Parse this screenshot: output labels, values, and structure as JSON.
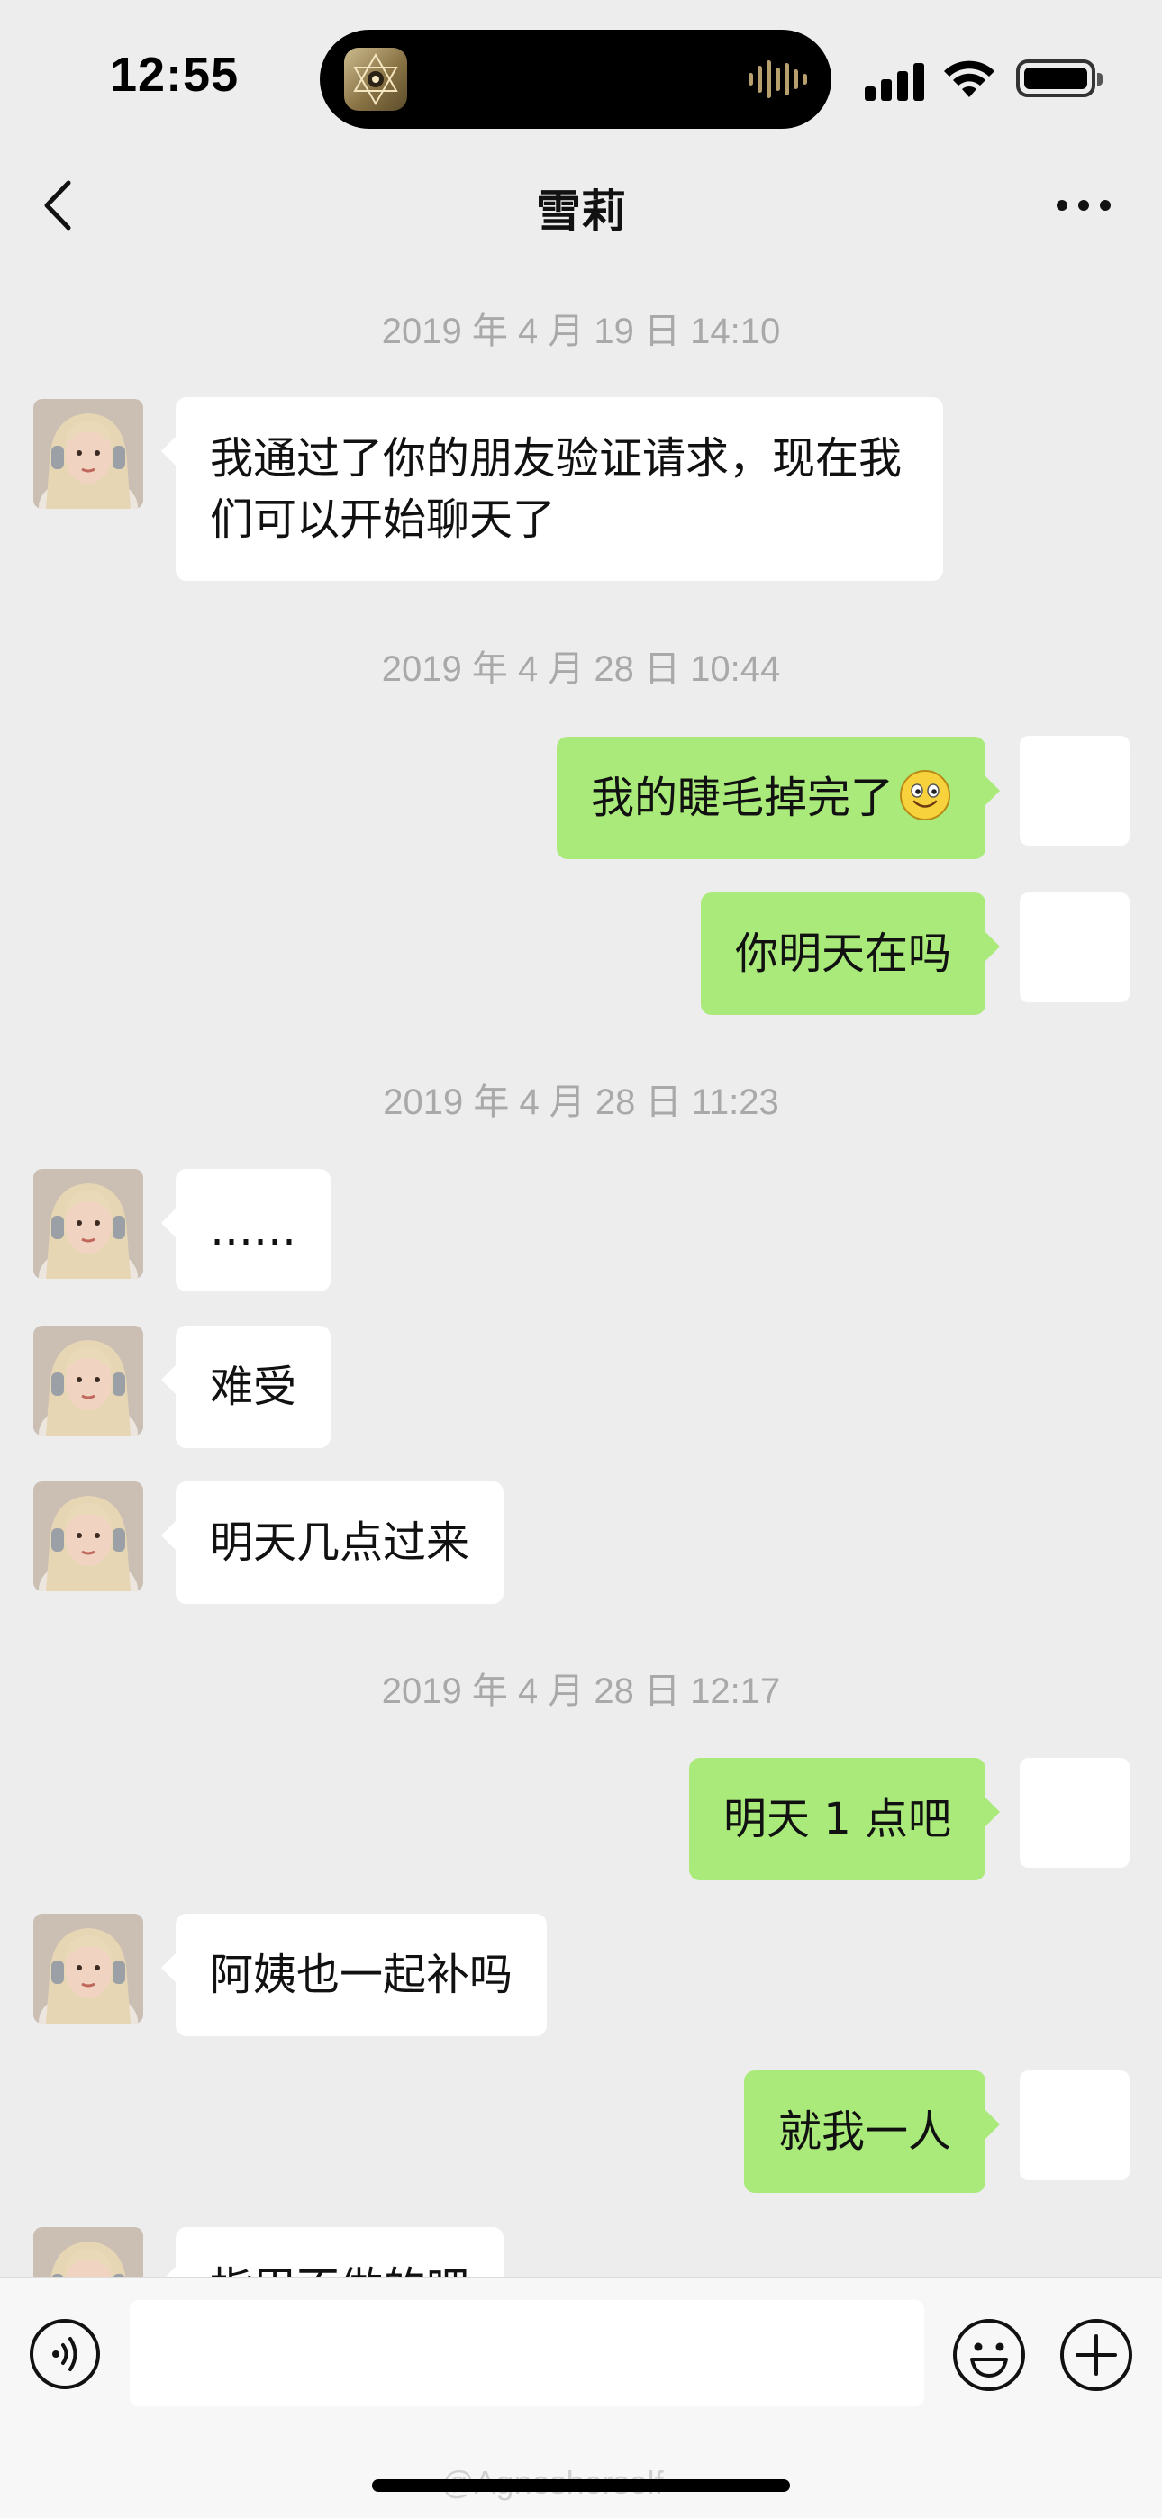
{
  "status_bar": {
    "time": "12:55"
  },
  "header": {
    "title": "雪莉"
  },
  "messages": {
    "ts1": "2019 年 4 月 19 日 14:10",
    "m1": "我通过了你的朋友验证请求，现在我们可以开始聊天了",
    "ts2": "2019 年 4 月 28 日 10:44",
    "m2": "我的睫毛掉完了",
    "m3": "你明天在吗",
    "ts3": "2019 年 4 月 28 日 11:23",
    "m4": "……",
    "m5": "难受",
    "m6": "明天几点过来",
    "ts4": "2019 年 4 月 28 日 12:17",
    "m7": "明天 1 点吧",
    "m8": "阿姨也一起补吗",
    "m9": "就我一人",
    "m10": "指甲不做的吧"
  },
  "emoji": {
    "m2_trailing": "smile-emoji"
  },
  "input_bar": {
    "value": "",
    "placeholder": ""
  },
  "watermark": {
    "text": "@Agnesherself"
  },
  "colors": {
    "background": "#ededed",
    "outgoing_bubble": "#a9ea7a",
    "incoming_bubble": "#ffffff",
    "timestamp_text": "#a9a9a9"
  }
}
